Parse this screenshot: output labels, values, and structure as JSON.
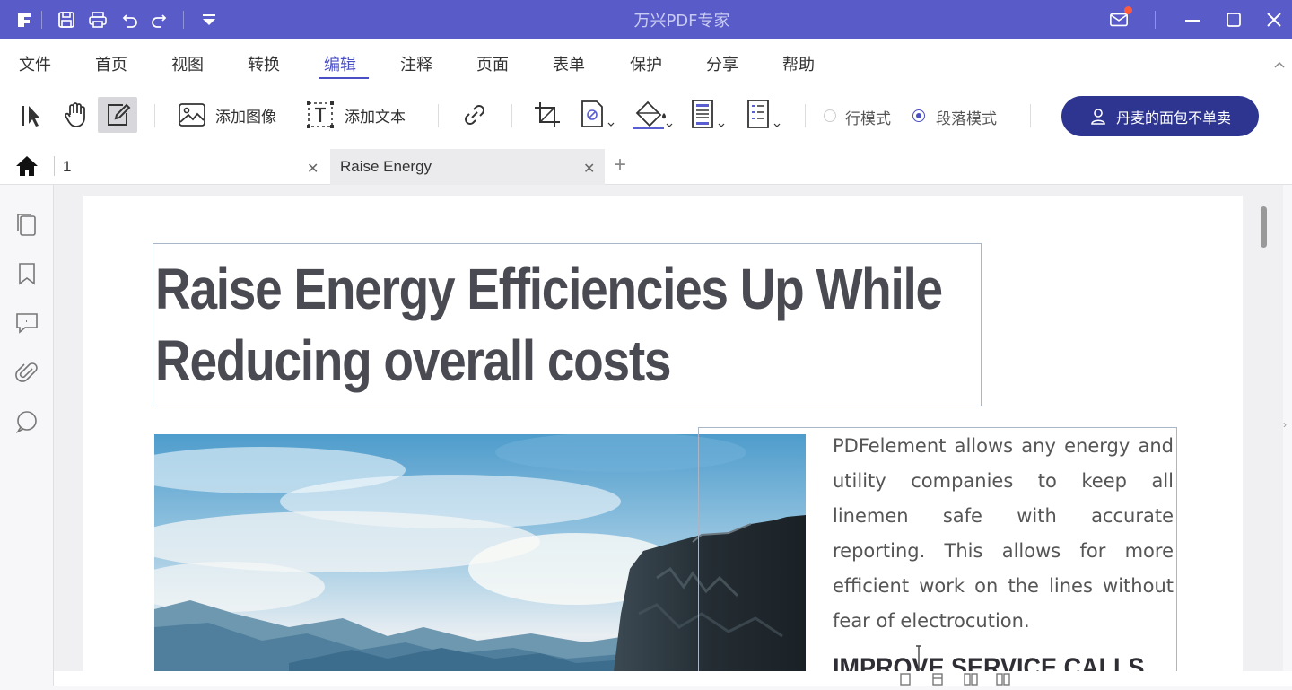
{
  "window": {
    "app_title": "万兴PDF专家"
  },
  "menu": {
    "items": [
      "文件",
      "首页",
      "视图",
      "转换",
      "编辑",
      "注释",
      "页面",
      "表单",
      "保护",
      "分享",
      "帮助"
    ],
    "active": "编辑"
  },
  "toolbar": {
    "add_image_label": "添加图像",
    "add_text_label": "添加文本",
    "line_mode_label": "行模式",
    "paragraph_mode_label": "段落模式",
    "selected_mode": "段落模式",
    "promo_label": "丹麦的面包不单卖"
  },
  "tabs": {
    "items": [
      {
        "label": "1"
      },
      {
        "label": "Raise Energy"
      }
    ],
    "active": "Raise Energy"
  },
  "document": {
    "title_line1": "Raise Energy Efficiencies Up While",
    "title_line2": "Reducing overall costs",
    "body": "PDFelement allows any energy and utility companies to keep all linemen safe with accurate reporting. This allows for more efficient work on the lines without fear of electrocution.",
    "subheading": "IMPROVE SERVICE CALLS"
  },
  "colors": {
    "title_bar": "#585bc8",
    "accent": "#4b4fc4",
    "promo_button": "#2d3591"
  }
}
